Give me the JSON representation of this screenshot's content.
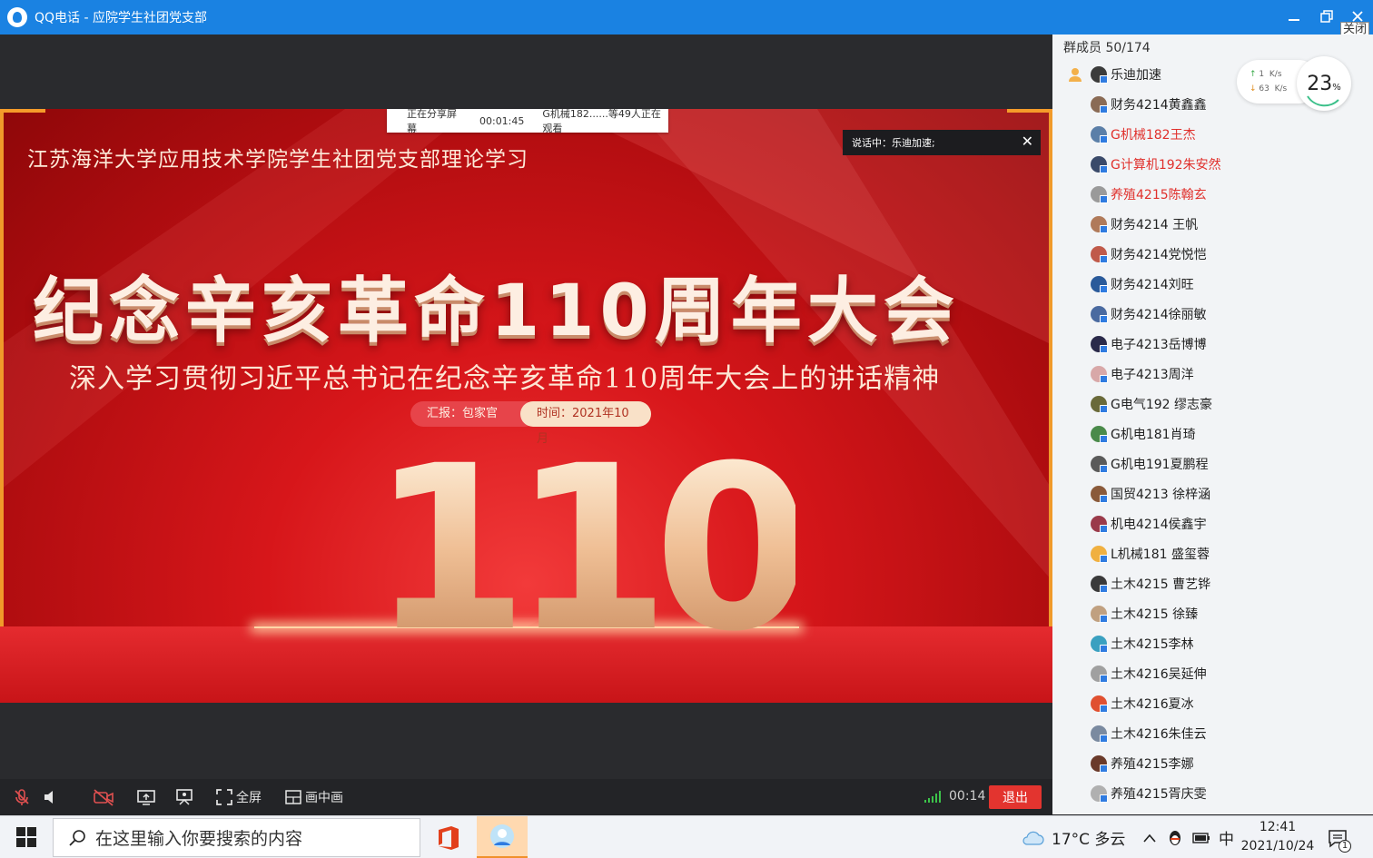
{
  "window": {
    "title": "QQ电话 - 应院学生社团党支部",
    "close_tooltip": "关闭"
  },
  "slide": {
    "school_title": "江苏海洋大学应用技术学院学生社团党支部理论学习",
    "main_title": "纪念辛亥革命110周年大会",
    "subtitle": "深入学习贯彻习近平总书记在纪念辛亥革命110周年大会上的讲话精神",
    "reporter": "汇报：包家官",
    "time": "时间：2021年10月",
    "big_number": "110"
  },
  "share_bar": {
    "status": "正在分享屏幕",
    "duration": "00:01:45",
    "viewers": "G机械182......等49人正在观看"
  },
  "speaking": {
    "label": "说话中：乐迪加速;"
  },
  "controls": {
    "fullscreen_label": "全屏",
    "pip_label": "画中画",
    "call_time": "00:14",
    "exit_label": "退出"
  },
  "network": {
    "upload": "1",
    "upload_unit": "K/s",
    "download": "63",
    "download_unit": "K/s",
    "cpu_percent": "23",
    "cpu_unit": "%"
  },
  "members": {
    "header": "群成员 50/174",
    "list": [
      {
        "name": "乐迪加速",
        "red": false
      },
      {
        "name": "财务4214黄鑫鑫",
        "red": false
      },
      {
        "name": "G机械182王杰",
        "red": true
      },
      {
        "name": "G计算机192朱安然",
        "red": true
      },
      {
        "name": "养殖4215陈翰玄",
        "red": true
      },
      {
        "name": "财务4214 王帆",
        "red": false
      },
      {
        "name": "财务4214党悦恺",
        "red": false
      },
      {
        "name": "财务4214刘旺",
        "red": false
      },
      {
        "name": "财务4214徐丽敏",
        "red": false
      },
      {
        "name": "电子4213岳博博",
        "red": false
      },
      {
        "name": "电子4213周洋",
        "red": false
      },
      {
        "name": "G电气192 缪志豪",
        "red": false
      },
      {
        "name": "G机电181肖琦",
        "red": false
      },
      {
        "name": "G机电191夏鹏程",
        "red": false
      },
      {
        "name": "国贸4213 徐梓涵",
        "red": false
      },
      {
        "name": "机电4214侯鑫宇",
        "red": false
      },
      {
        "name": "L机械181 盛玺蓉",
        "red": false
      },
      {
        "name": "土木4215 曹艺铧",
        "red": false
      },
      {
        "name": "土木4215 徐臻",
        "red": false
      },
      {
        "name": "土木4215李林",
        "red": false
      },
      {
        "name": "土木4216吴延伸",
        "red": false
      },
      {
        "name": "土木4216夏冰",
        "red": false
      },
      {
        "name": "土木4216朱佳云",
        "red": false
      },
      {
        "name": "养殖4215李娜",
        "red": false
      },
      {
        "name": "养殖4215胥庆雯",
        "red": false
      }
    ]
  },
  "taskbar": {
    "search_placeholder": "在这里输入你要搜索的内容",
    "weather": "17°C 多云",
    "ime": "中",
    "time": "12:41",
    "date": "2021/10/24",
    "notification_count": "1"
  }
}
